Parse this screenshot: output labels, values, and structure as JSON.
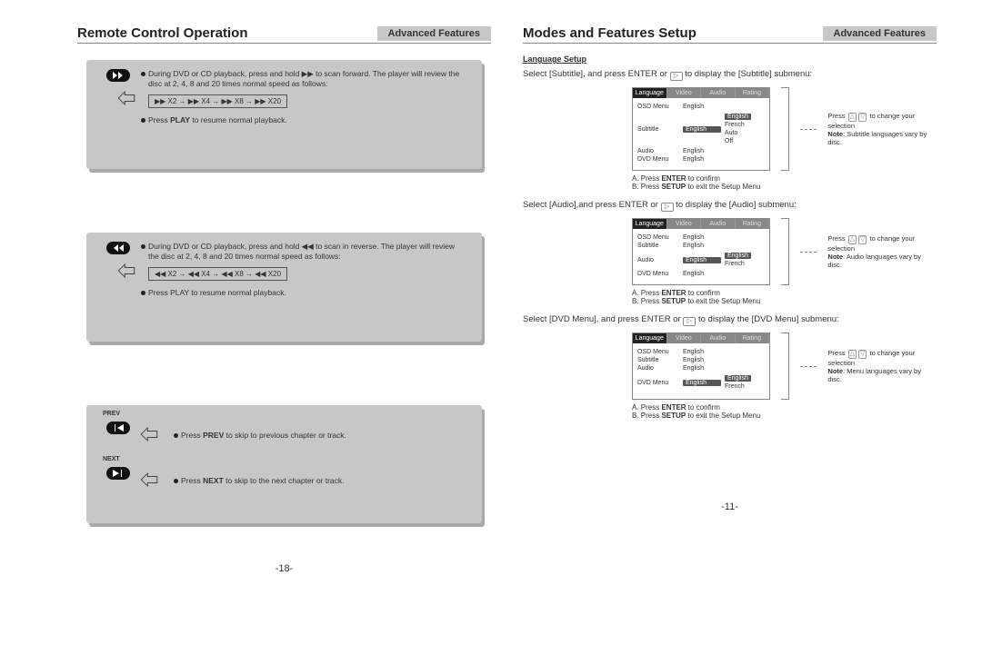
{
  "left": {
    "title": "Remote Control Operation",
    "adv": "Advanced Features",
    "block1_l1": "During DVD or CD playback, press and hold ▶▶ to scan forward.",
    "block1_l2": "The player will review the disc at 2, 4, 8 and 20 times normal speed as follows:",
    "block1_speed": "▶▶ X2 → ▶▶ X4 → ▶▶ X8 → ▶▶ X20",
    "block1_l3a": "Press ",
    "block1_l3b": "PLAY",
    "block1_l3c": " to resume normal playback.",
    "block2_l1": "During DVD or CD playback, press and hold ◀◀ to scan in reverse.",
    "block2_l2": "The player will review the disc at 2, 4, 8 and 20 times normal speed as follows:",
    "block2_speed": "◀◀ X2 → ◀◀ X4 → ◀◀ X8 → ◀◀ X20",
    "block2_l3": "Press PLAY to resume normal playback.",
    "prev_label": "PREV",
    "next_label": "NEXT",
    "prev_a": "Press ",
    "prev_b": "PREV",
    "prev_c": " to skip to previous chapter or track.",
    "next_a": "Press ",
    "next_b": "NEXT",
    "next_c": " to skip to the next chapter or track.",
    "page_num": "-18-"
  },
  "right": {
    "title": "Modes and Features Setup",
    "adv": "Advanced Features",
    "sec": "Language Setup",
    "sub_a": "Select [Subtitle], and press ENTER or ",
    "sub_b": " to display the [Subtitle] submenu:",
    "aud_a": "Select [Audio],and press ENTER or ",
    "aud_b": " to display the [Audio] submenu:",
    "dvd_a": "Select [DVD Menu], and press ENTER or ",
    "dvd_b": " to display the [DVD Menu] submenu:",
    "tabs": {
      "language": "Language",
      "video": "Video",
      "audio": "Audio",
      "rating": "Rating"
    },
    "rows": {
      "osd": "OSD Menu",
      "subtitle": "Subtitle",
      "audio": "Audio",
      "dvdmenu": "DVD Menu"
    },
    "vals": {
      "english": "English",
      "french": "French",
      "auto": "Auto",
      "off": "Off"
    },
    "side_press": "Press ",
    "side_change": " to change your selection",
    "note_pre": "Note",
    "note_sub": ": Subtitle languages vary by disc.",
    "note_aud": ": Audio languages vary by disc.",
    "note_menu": ": Menu languages vary by disc.",
    "conf_a_pre": "A.  Press ",
    "conf_a_b": "ENTER",
    "conf_a_post": " to confirm",
    "conf_b_pre": "B.  Press ",
    "conf_b_b": "SETUP",
    "conf_b_post": " to exit the Setup Menu",
    "page_num": "-11-"
  }
}
